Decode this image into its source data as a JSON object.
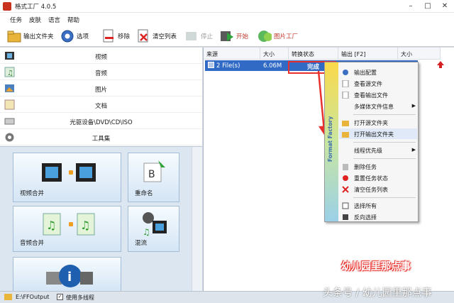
{
  "window": {
    "title": "格式工厂 4.0.5",
    "min": "–",
    "max": "□",
    "close": "✕"
  },
  "menu": [
    "任务",
    "皮肤",
    "语言",
    "帮助"
  ],
  "toolbar": [
    {
      "label": "输出文件夹",
      "icon": "folder-icon"
    },
    {
      "label": "选项",
      "icon": "options-icon"
    },
    {
      "label": "移除",
      "icon": "remove-icon"
    },
    {
      "label": "清空列表",
      "icon": "clear-list-icon"
    },
    {
      "label": "停止",
      "icon": "stop-icon"
    },
    {
      "label": "开始",
      "icon": "start-icon"
    },
    {
      "label": "图片工厂",
      "icon": "picture-factory-icon"
    }
  ],
  "nav": [
    "视频",
    "音频",
    "图片",
    "文档",
    "光驱设备\\DVD\\CD\\ISO",
    "工具集"
  ],
  "tools": [
    "视频合并",
    "重命名",
    "音频合并",
    "混流",
    ""
  ],
  "list": {
    "headers": [
      "来源",
      "大小",
      "转换状态",
      "输出 [F2]",
      "大小"
    ],
    "row": {
      "source": "2 File(s)",
      "size": "6.06M",
      "status": "完成"
    }
  },
  "context_menu": {
    "side": "Format Factory",
    "items": [
      {
        "label": "输出配置",
        "icon": "settings-icon"
      },
      {
        "label": "查看源文件",
        "icon": "file-icon"
      },
      {
        "label": "查看输出文件",
        "icon": "file-icon"
      },
      {
        "label": "多媒体文件信息",
        "icon": "",
        "submenu": true
      },
      {
        "label": "打开源文件夹",
        "icon": "folder-icon"
      },
      {
        "label": "打开输出文件夹",
        "icon": "folder-icon"
      },
      {
        "label": "线程优先级",
        "icon": "",
        "submenu": true
      },
      {
        "label": "删除任务",
        "icon": "delete-icon"
      },
      {
        "label": "重置任务状态",
        "icon": "reset-icon"
      },
      {
        "label": "清空任务列表",
        "icon": "clear-icon"
      },
      {
        "label": "选择所有",
        "icon": "select-all-icon"
      },
      {
        "label": "反向选择",
        "icon": "invert-select-icon"
      }
    ]
  },
  "status": {
    "path": "E:\\FFOutput",
    "multithread": "使用多线程"
  },
  "watermark": {
    "brand": "幼儿园里那点事",
    "credit": "头条号 / 幼儿园里那点事"
  }
}
